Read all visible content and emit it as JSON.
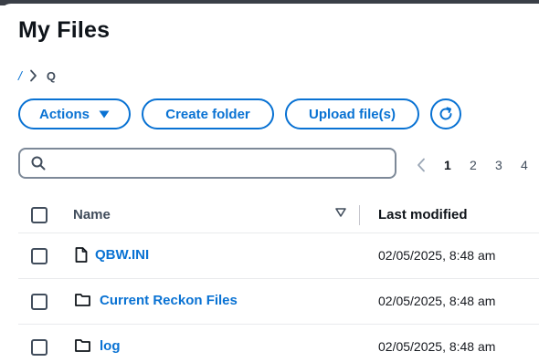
{
  "page": {
    "title": "My Files"
  },
  "breadcrumb": {
    "root": "/",
    "current": "Q"
  },
  "toolbar": {
    "actions_label": "Actions",
    "create_folder_label": "Create folder",
    "upload_label": "Upload file(s)"
  },
  "search": {
    "value": "",
    "placeholder": ""
  },
  "pagination": {
    "pages": [
      "1",
      "2",
      "3",
      "4"
    ],
    "current": "1"
  },
  "table": {
    "headers": {
      "name": "Name",
      "last_modified": "Last modified"
    },
    "rows": [
      {
        "type": "file",
        "icon": "file-icon",
        "name": "QBW.INI",
        "last_modified": "02/05/2025, 8:48 am"
      },
      {
        "type": "folder",
        "icon": "folder-icon",
        "name": "Current Reckon Files",
        "last_modified": "02/05/2025, 8:48 am"
      },
      {
        "type": "folder",
        "icon": "folder-icon",
        "name": "log",
        "last_modified": "02/05/2025, 8:48 am"
      }
    ]
  },
  "colors": {
    "accent": "#0972d3",
    "text": "#16191f",
    "border": "#7d8998"
  }
}
